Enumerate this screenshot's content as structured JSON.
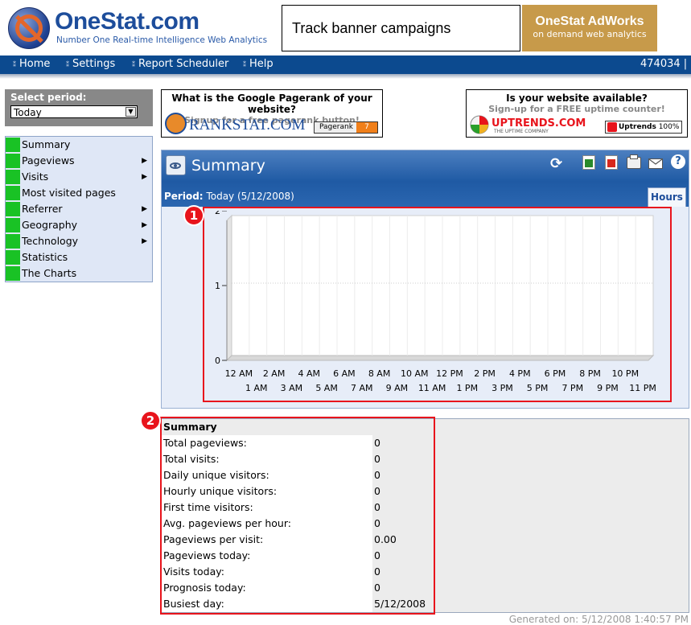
{
  "header": {
    "brand": "OneStat.com",
    "tagline": "Number One Real-time Intelligence Web Analytics",
    "banner_left": "Track banner campaigns",
    "banner_right_title": "OneStat AdWorks",
    "banner_right_sub": "on demand web analytics"
  },
  "nav": {
    "items": [
      "Home",
      "Settings",
      "Report Scheduler",
      "Help"
    ],
    "account_id": "474034 |"
  },
  "period_select": {
    "label": "Select period:",
    "value": "Today"
  },
  "menu": {
    "items": [
      {
        "label": "Summary",
        "submenu": false
      },
      {
        "label": "Pageviews",
        "submenu": true
      },
      {
        "label": "Visits",
        "submenu": true
      },
      {
        "label": "Most visited pages",
        "submenu": false
      },
      {
        "label": "Referrer",
        "submenu": true
      },
      {
        "label": "Geography",
        "submenu": true
      },
      {
        "label": "Technology",
        "submenu": true
      },
      {
        "label": "Statistics",
        "submenu": false
      },
      {
        "label": "The Charts",
        "submenu": false
      }
    ]
  },
  "ads": {
    "rankstat": {
      "headline": "What is the Google Pagerank of your website?",
      "sub": "Signup for a free pagerank button!",
      "logo": "RANKSTAT.COM",
      "button_label": "Pagerank",
      "button_value": "7"
    },
    "uptrends": {
      "headline": "Is your website available?",
      "sub": "Sign-up for a FREE uptime counter!",
      "logo": "UPTRENDS.COM",
      "logo_sub": "THE UPTIME COMPANY",
      "button_label": "Uptrends",
      "button_value": "100%"
    }
  },
  "summary_panel": {
    "title": "Summary",
    "period_label": "Period:",
    "period_value": "Today (5/12/2008)",
    "tab": "Hours"
  },
  "badges": [
    "1",
    "2"
  ],
  "chart_data": {
    "type": "bar",
    "categories": [
      "12 AM",
      "1 AM",
      "2 AM",
      "3 AM",
      "4 AM",
      "5 AM",
      "6 AM",
      "7 AM",
      "8 AM",
      "9 AM",
      "10 AM",
      "11 AM",
      "12 PM",
      "1 PM",
      "2 PM",
      "3 PM",
      "4 PM",
      "5 PM",
      "6 PM",
      "7 PM",
      "8 PM",
      "9 PM",
      "10 PM",
      "11 PM"
    ],
    "values": [
      0,
      0,
      0,
      0,
      0,
      0,
      0,
      0,
      0,
      0,
      0,
      0,
      0,
      0,
      0,
      0,
      0,
      0,
      0,
      0,
      0,
      0,
      0,
      0
    ],
    "yticks": [
      "0",
      "1",
      "2"
    ],
    "ylim": [
      0,
      2
    ],
    "grid": true,
    "title": "",
    "xlabel": "",
    "ylabel": ""
  },
  "stats": {
    "heading": "Summary",
    "rows": [
      {
        "label": "Total pageviews:",
        "value": "0"
      },
      {
        "label": "Total visits:",
        "value": "0"
      },
      {
        "label": "Daily unique visitors:",
        "value": "0"
      },
      {
        "label": "Hourly unique visitors:",
        "value": "0"
      },
      {
        "label": "First time visitors:",
        "value": "0"
      },
      {
        "label": "Avg. pageviews per hour:",
        "value": "0"
      },
      {
        "label": "Pageviews per visit:",
        "value": "0.00"
      },
      {
        "label": "Pageviews today:",
        "value": "0"
      },
      {
        "label": "Visits today:",
        "value": "0"
      },
      {
        "label": "Prognosis today:",
        "value": "0"
      },
      {
        "label": "Busiest day:",
        "value": "5/12/2008"
      }
    ]
  },
  "footer": "Generated on:  5/12/2008 1:40:57 PM",
  "colors": {
    "nav": "#0c4a8f",
    "accent_green": "#19c225",
    "highlight_red": "#e8141c"
  }
}
